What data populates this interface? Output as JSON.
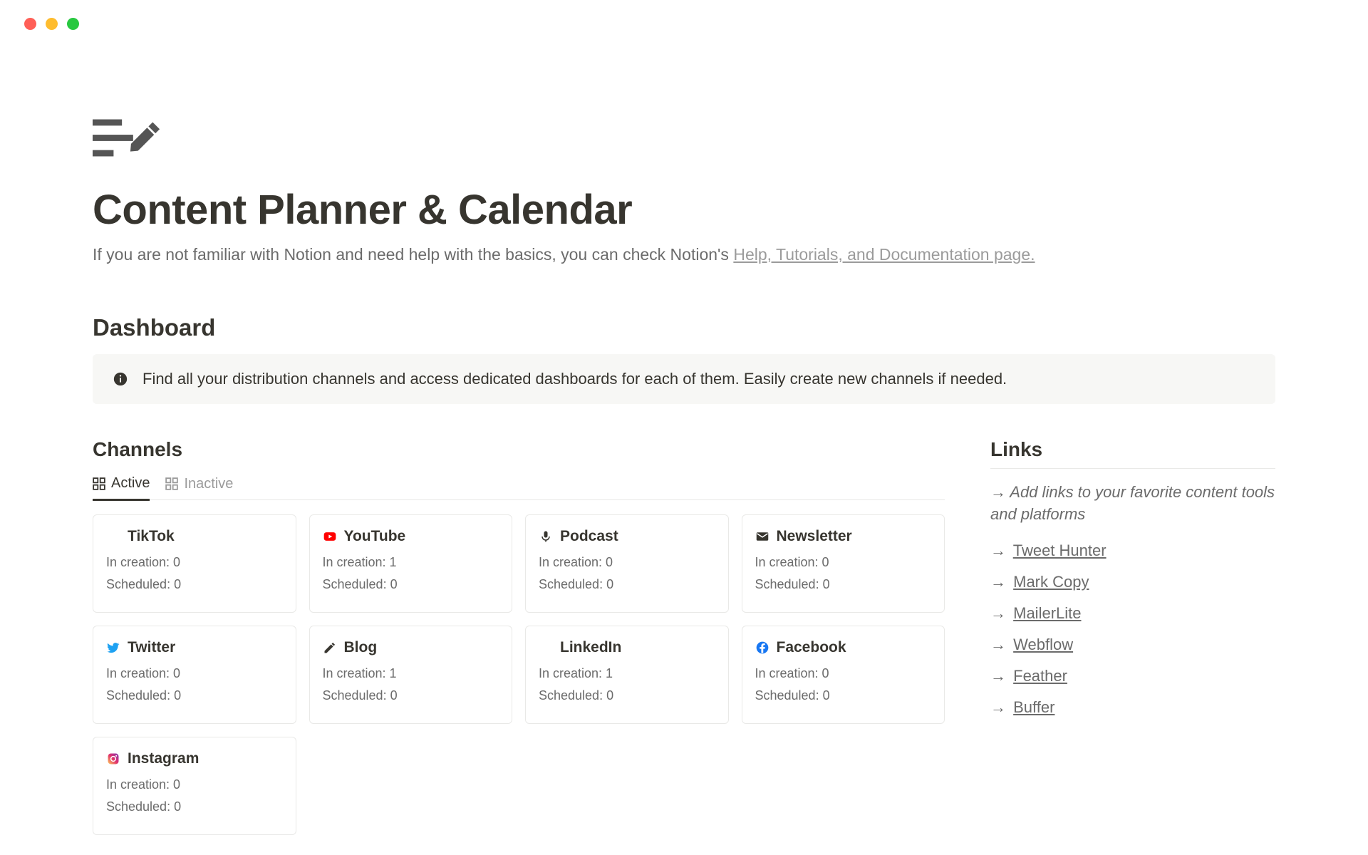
{
  "page": {
    "title": "Content Planner & Calendar",
    "help_prefix": "If you are not familiar with Notion and need help with the basics, you can check Notion's ",
    "help_link": "Help, Tutorials, and Documentation page."
  },
  "dashboard": {
    "heading": "Dashboard",
    "callout": "Find all your distribution channels and access dedicated dashboards for each of them. Easily create new channels if needed."
  },
  "channels": {
    "heading": "Channels",
    "tabs": [
      {
        "label": "Active",
        "active": true
      },
      {
        "label": "Inactive",
        "active": false
      }
    ],
    "cards": [
      {
        "name": "TikTok",
        "icon": "tiktok",
        "in_creation": "In creation: 0",
        "scheduled": "Scheduled: 0"
      },
      {
        "name": "YouTube",
        "icon": "youtube",
        "in_creation": "In creation: 1",
        "scheduled": "Scheduled: 0"
      },
      {
        "name": "Podcast",
        "icon": "mic",
        "in_creation": "In creation: 0",
        "scheduled": "Scheduled: 0"
      },
      {
        "name": "Newsletter",
        "icon": "mail",
        "in_creation": "In creation: 0",
        "scheduled": "Scheduled: 0"
      },
      {
        "name": "Twitter",
        "icon": "twitter",
        "in_creation": "In creation: 0",
        "scheduled": "Scheduled: 0"
      },
      {
        "name": "Blog",
        "icon": "pencil",
        "in_creation": "In creation: 1",
        "scheduled": "Scheduled: 0"
      },
      {
        "name": "LinkedIn",
        "icon": "linkedin",
        "in_creation": "In creation: 1",
        "scheduled": "Scheduled: 0"
      },
      {
        "name": "Facebook",
        "icon": "facebook",
        "in_creation": "In creation: 0",
        "scheduled": "Scheduled: 0"
      },
      {
        "name": "Instagram",
        "icon": "instagram",
        "in_creation": "In creation: 0",
        "scheduled": "Scheduled: 0"
      }
    ]
  },
  "links": {
    "heading": "Links",
    "help_arrow": "→",
    "help": "Add links to your favorite content tools and platforms",
    "items": [
      {
        "arrow": "→",
        "label": "Tweet Hunter"
      },
      {
        "arrow": "→",
        "label": "Mark Copy"
      },
      {
        "arrow": "→",
        "label": "MailerLite"
      },
      {
        "arrow": "→",
        "label": "Webflow"
      },
      {
        "arrow": "→",
        "label": "Feather"
      },
      {
        "arrow": "→",
        "label": "Buffer"
      }
    ]
  }
}
